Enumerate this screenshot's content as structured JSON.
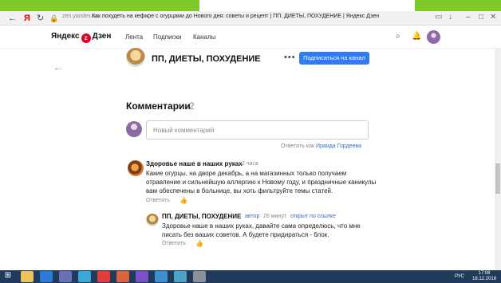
{
  "browser": {
    "url": "zen.yandex.ru",
    "tab_title": "Как похудеть на кефире с огурцами до Нового дня: советы и рецепт | ПП, ДИЕТЫ, ПОХУДЕНИЕ | Яндекс Дзен"
  },
  "header": {
    "logo_text": "Яндекс",
    "logo_zen": "Дзен",
    "nav": [
      "Лента",
      "Подписки",
      "Каналы"
    ]
  },
  "channel": {
    "name": "ПП, ДИЕТЫ, ПОХУДЕНИЕ",
    "subscribe_label": "Подписаться на канал"
  },
  "comments": {
    "title": "Комментарии",
    "count": "2",
    "input_placeholder": "Новый комментарий",
    "reply_as_prefix": "Ответить как",
    "reply_as_name": "Ираида Гордеева",
    "items": [
      {
        "author": "Здоровье наше в наших руках",
        "time": "2 часа",
        "text": "Какие огурцы, на дворе декабрь, а на магазинных только получаем отравление и сильнейшую аллергию к Новому году, и праздничные каникулы вам обеспечены в больнице, вы хоть фильтруйте темы статей.",
        "reply_label": "Ответить"
      },
      {
        "author": "ПП, ДИЕТЫ, ПОХУДЕНИЕ",
        "badge": "автор",
        "time": "26 минут",
        "link": "открыт по ссылке",
        "text": "Здоровье наше в наших руках, давайте сама определюсь, что мне писать без ваших советов. А будете придираться - блок.",
        "reply_label": "Ответить"
      }
    ]
  },
  "taskbar": {
    "lang": "РУС",
    "time": "17:08",
    "date": "18.12.2018"
  }
}
